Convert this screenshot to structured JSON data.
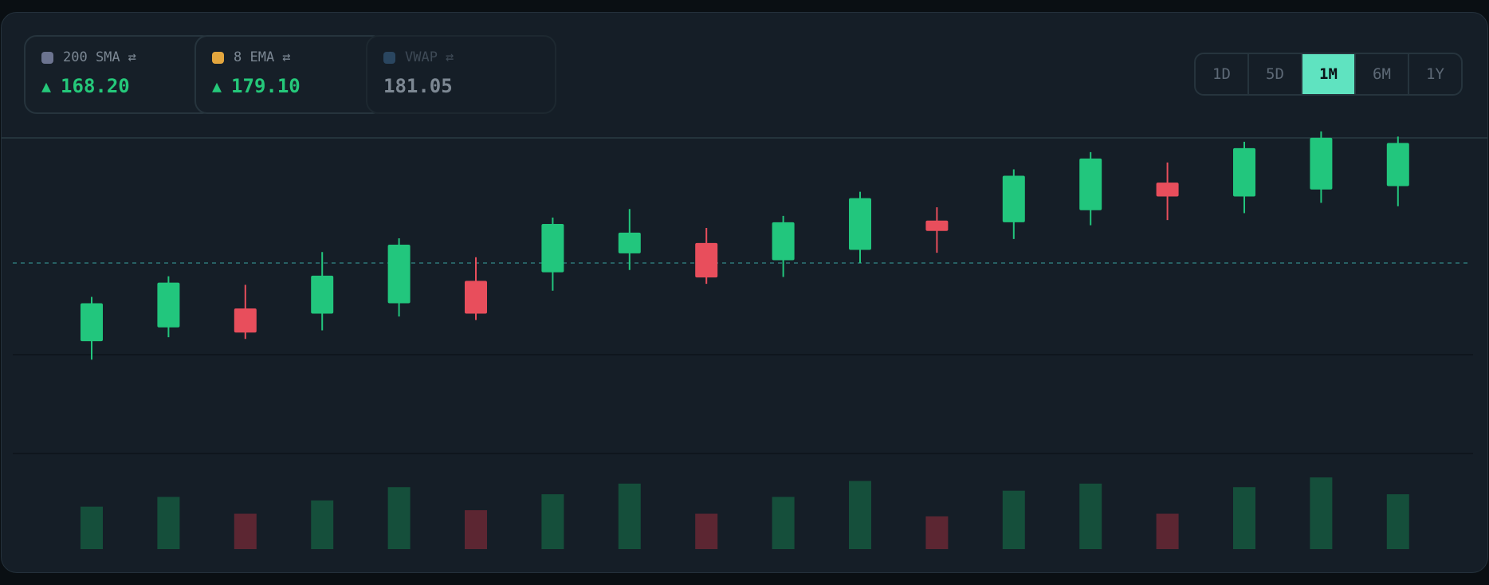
{
  "indicators": [
    {
      "name": "200 SMA",
      "swap": "⇄",
      "value": "168.20",
      "trend": "▲",
      "color": "#6c7490",
      "dim": false
    },
    {
      "name": "8 EMA",
      "swap": "⇄",
      "value": "179.10",
      "trend": "▲",
      "color": "#e3a63e",
      "dim": false
    },
    {
      "name": "VWAP",
      "swap": "⇄",
      "value": "181.05",
      "trend": "",
      "color": "#2a4660",
      "dim": true
    }
  ],
  "timeframes": {
    "options": [
      "1D",
      "5D",
      "1M",
      "6M",
      "1Y"
    ],
    "selected": "1M"
  },
  "colors": {
    "up": "#22c67d",
    "down": "#e84e5c",
    "up_volume": "#154f3b",
    "down_volume": "#5c2632",
    "reference_line": "#3aa3a0",
    "accent": "#5fe3c0"
  },
  "chart_data": {
    "type": "candlestick",
    "price_range": [
      150,
      190
    ],
    "reference_level": 182,
    "candles": [
      {
        "open": 152.0,
        "high": 157.0,
        "low": 148.5,
        "close": 163.0
      },
      {
        "open": 156.0,
        "high": 167.0,
        "low": 155.0,
        "close": 169.0
      },
      {
        "open": 161.5,
        "high": 166.5,
        "low": 157.0,
        "close": 154.5
      },
      {
        "open": 160.0,
        "high": 176.0,
        "low": 157.0,
        "close": 171.0
      },
      {
        "open": 163.0,
        "high": 175.0,
        "low": 161.0,
        "close": 180.0
      },
      {
        "open": 169.5,
        "high": 174.5,
        "low": 164.0,
        "close": 160.0
      },
      {
        "open": 172.0,
        "high": 183.0,
        "low": 168.5,
        "close": 186.0
      },
      {
        "open": 177.5,
        "high": 188.5,
        "low": 174.5,
        "close": 183.5
      },
      {
        "open": 180.5,
        "high": 183.0,
        "low": 173.0,
        "close": 170.5
      },
      {
        "open": 175.5,
        "high": 184.5,
        "low": 172.5,
        "close": 186.5
      },
      {
        "open": 178.5,
        "high": 190.0,
        "low": 176.5,
        "close": 193.5
      },
      {
        "open": 187.0,
        "high": 189.0,
        "low": 179.5,
        "close": 184.0
      },
      {
        "open": 186.5,
        "high": 197.0,
        "low": 183.5,
        "close": 200.0
      },
      {
        "open": 190.0,
        "high": 201.0,
        "low": 187.5,
        "close": 205.0
      },
      {
        "open": 198.0,
        "high": 202.0,
        "low": 189.0,
        "close": 194.0
      },
      {
        "open": 194.0,
        "high": 205.0,
        "low": 191.0,
        "close": 208.0
      },
      {
        "open": 196.0,
        "high": 207.0,
        "low": 194.0,
        "close": 211.0
      },
      {
        "open": 197.0,
        "high": 205.0,
        "low": 193.0,
        "close": 209.5
      }
    ],
    "volumes": [
      48,
      59,
      40,
      55,
      70,
      44,
      62,
      74,
      40,
      59,
      77,
      37,
      66,
      74,
      40,
      70,
      81,
      62
    ]
  }
}
